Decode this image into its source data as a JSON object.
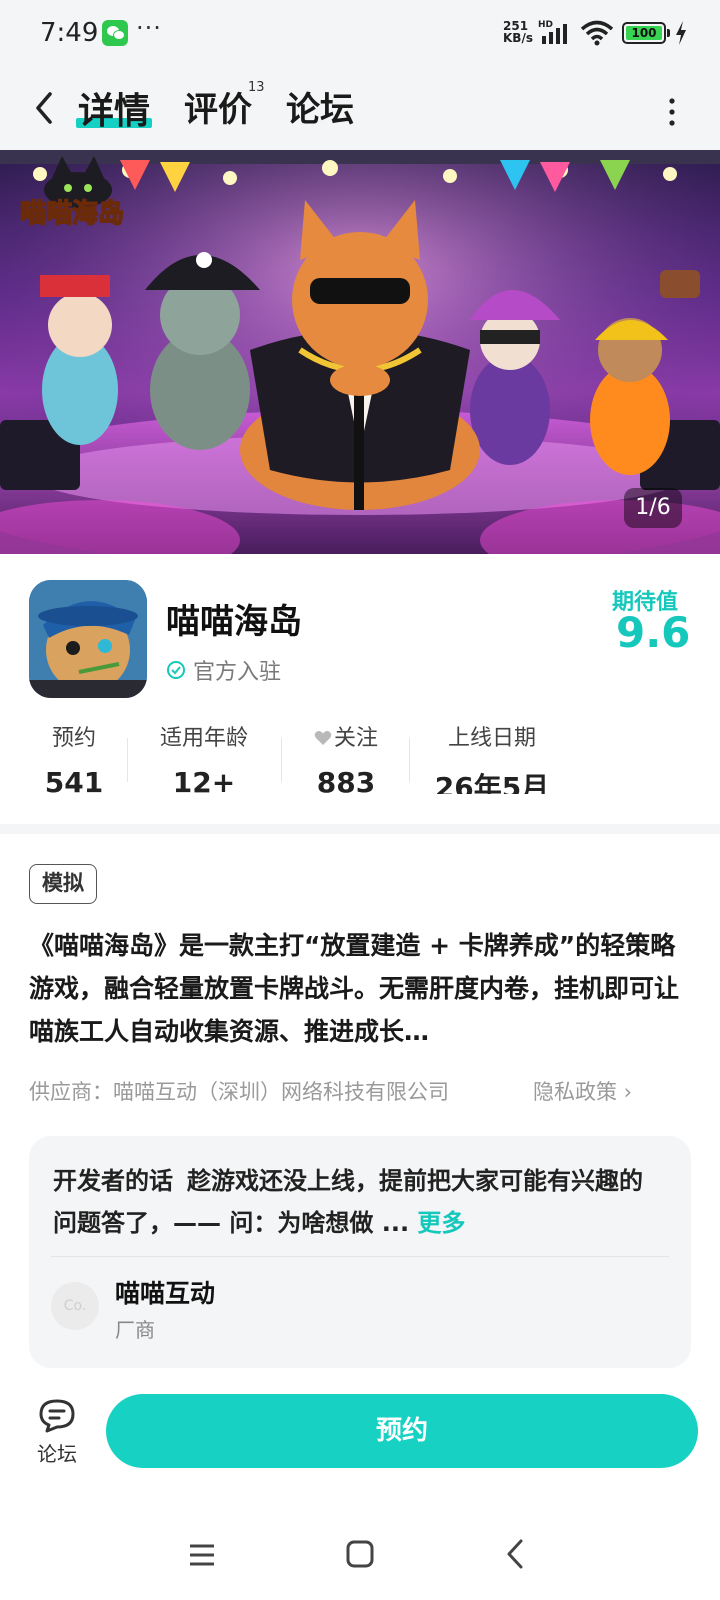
{
  "status_bar": {
    "time": "7:49",
    "dots": "···",
    "net_speed_value": "251",
    "net_speed_unit": "KB/s",
    "hd": "HD",
    "battery": "100"
  },
  "header": {
    "tabs": [
      {
        "label": "详情",
        "active": true
      },
      {
        "label": "评价",
        "count": "13"
      },
      {
        "label": "论坛"
      }
    ]
  },
  "hero": {
    "logo_text": "喵喵海岛",
    "counter": "1/6"
  },
  "app": {
    "name": "喵喵海岛",
    "official": "官方入驻",
    "expect_label": "期待值",
    "expect_score": "9.6",
    "stats": [
      {
        "label": "预约",
        "value": "541"
      },
      {
        "label": "适用年龄",
        "value": "12+"
      },
      {
        "label": "关注",
        "value": "883"
      },
      {
        "label": "上线日期",
        "value": "26年5月"
      }
    ]
  },
  "description": {
    "tag": "模拟",
    "text": "《喵喵海岛》是一款主打“放置建造 + 卡牌养成”的轻策略游戏，融合轻量放置卡牌战斗。无需肝度内卷，挂机即可让喵族工人自动收集资源、推进成长…",
    "supplier": "供应商：喵喵互动（深圳）网络科技有限公司",
    "privacy": "隐私政策 ›"
  },
  "developer": {
    "title": "开发者的话",
    "text": "趁游戏还没上线，提前把大家可能有兴趣的问题答了，—— 问：为啥想做 ...",
    "more": "更多",
    "avatar_text": "Co.",
    "name": "喵喵互动",
    "role": "厂商"
  },
  "bottom_bar": {
    "forum_label": "论坛",
    "reserve_label": "预约"
  },
  "colors": {
    "accent": "#16c8bc",
    "button": "#17d1c3",
    "background_band": "#f4f5f6"
  }
}
